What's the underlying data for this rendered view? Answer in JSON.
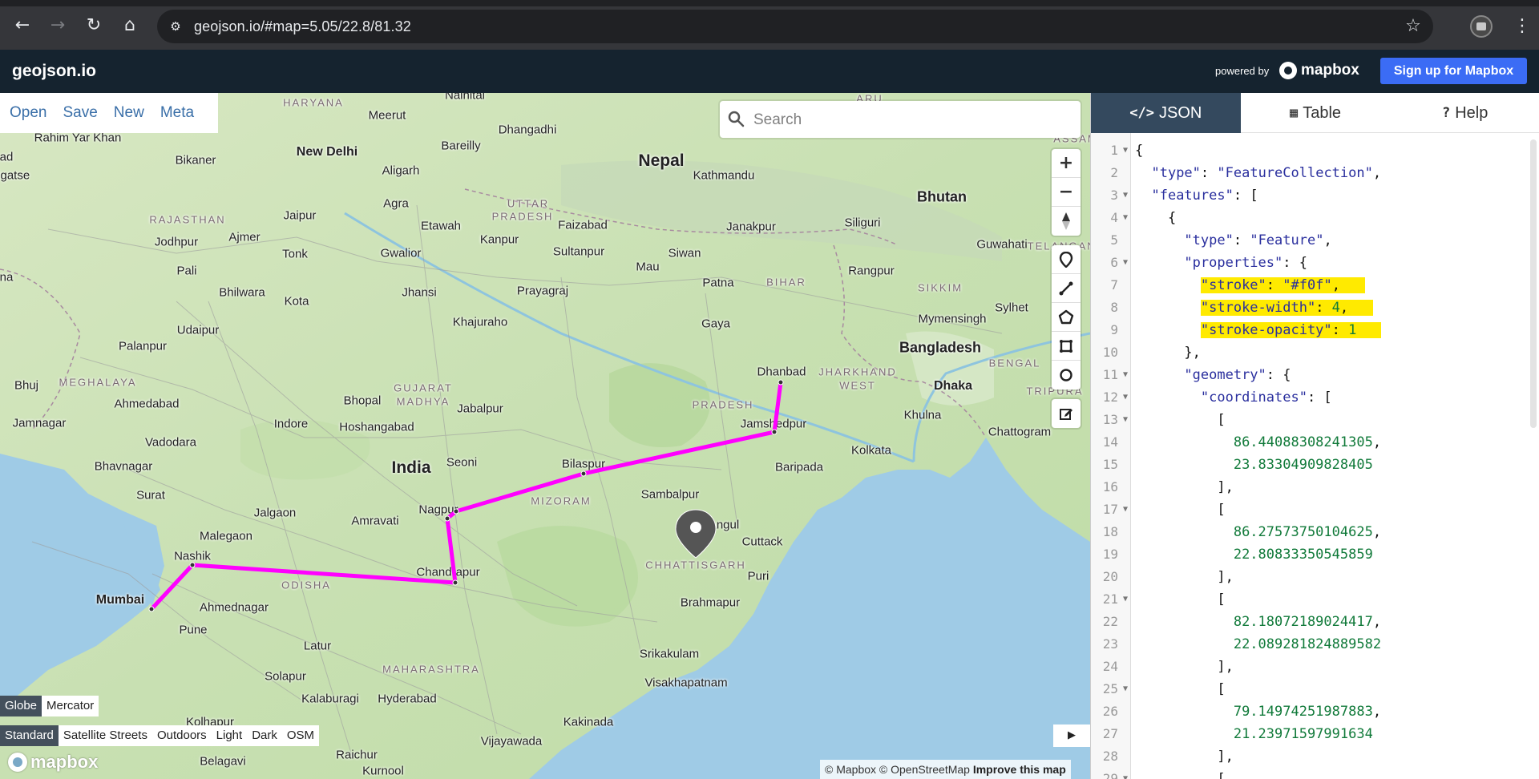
{
  "browser": {
    "url": "geojson.io/#map=5.05/22.8/81.32",
    "back_icon": "arrow-left-icon",
    "forward_icon": "arrow-right-icon",
    "reload_icon": "reload-icon",
    "home_icon": "home-icon",
    "star_icon": "star-icon"
  },
  "header": {
    "brand": "geojson.io",
    "powered_by": "powered by",
    "mapbox": "mapbox",
    "signup": "Sign up for Mapbox"
  },
  "file_menu": [
    "Open",
    "Save",
    "New",
    "Meta"
  ],
  "search": {
    "placeholder": "Search"
  },
  "projection": {
    "options": [
      "Globe",
      "Mercator"
    ],
    "active": "Globe"
  },
  "styles": {
    "options": [
      "Standard",
      "Satellite Streets",
      "Outdoors",
      "Light",
      "Dark",
      "OSM"
    ],
    "active": "Standard"
  },
  "attribution": {
    "mapbox": "© Mapbox",
    "osm": "© OpenStreetMap",
    "improve": "Improve this map"
  },
  "map_logo": "mapbox",
  "tabs": [
    {
      "icon": "</>",
      "label": "JSON"
    },
    {
      "icon": "▦",
      "label": "Table"
    },
    {
      "icon": "?",
      "label": "Help"
    }
  ],
  "active_tab": "JSON",
  "line_color": "#f0f",
  "map_labels": [
    {
      "text": "Nepal",
      "cls": "big"
    },
    {
      "text": "India",
      "cls": "big"
    },
    {
      "text": "Bhutan",
      "cls": "country"
    },
    {
      "text": "Bangladesh",
      "cls": "country"
    },
    {
      "text": "New Delhi",
      "cls": "medium"
    },
    {
      "text": "Mumbai",
      "cls": "medium"
    },
    {
      "text": "Dhaka",
      "cls": "medium"
    },
    {
      "text": "Kathmandu",
      "cls": "city"
    },
    {
      "text": "Meerut",
      "cls": "city"
    },
    {
      "text": "Bareilly",
      "cls": "city"
    },
    {
      "text": "Aligarh",
      "cls": "city"
    },
    {
      "text": "Agra",
      "cls": "city"
    },
    {
      "text": "Jaipur",
      "cls": "city"
    },
    {
      "text": "Bikaner",
      "cls": "city"
    },
    {
      "text": "Rahim Yar Khan",
      "cls": "city"
    },
    {
      "text": "Jodhpur",
      "cls": "city"
    },
    {
      "text": "Ajmer",
      "cls": "city"
    },
    {
      "text": "Pali",
      "cls": "city"
    },
    {
      "text": "Tonk",
      "cls": "city"
    },
    {
      "text": "Gwalior",
      "cls": "city"
    },
    {
      "text": "Etawah",
      "cls": "city"
    },
    {
      "text": "Kanpur",
      "cls": "city"
    },
    {
      "text": "Faizabad",
      "cls": "city"
    },
    {
      "text": "Sultanpur",
      "cls": "city"
    },
    {
      "text": "Janakpur",
      "cls": "city"
    },
    {
      "text": "Siliguri",
      "cls": "city"
    },
    {
      "text": "Guwahati",
      "cls": "city"
    },
    {
      "text": "Rangpur",
      "cls": "city"
    },
    {
      "text": "Siwan",
      "cls": "city"
    },
    {
      "text": "Mau",
      "cls": "city"
    },
    {
      "text": "Patna",
      "cls": "city"
    },
    {
      "text": "Prayagraj",
      "cls": "city"
    },
    {
      "text": "Jhansi",
      "cls": "city"
    },
    {
      "text": "Bhilwara",
      "cls": "city"
    },
    {
      "text": "Kota",
      "cls": "city"
    },
    {
      "text": "Udaipur",
      "cls": "city"
    },
    {
      "text": "Palanpur",
      "cls": "city"
    },
    {
      "text": "Khajuraho",
      "cls": "city"
    },
    {
      "text": "Gaya",
      "cls": "city"
    },
    {
      "text": "Mymensingh",
      "cls": "city"
    },
    {
      "text": "Sylhet",
      "cls": "city"
    },
    {
      "text": "Dhanbad",
      "cls": "city"
    },
    {
      "text": "Bhuj",
      "cls": "city"
    },
    {
      "text": "Ahmedabad",
      "cls": "city"
    },
    {
      "text": "Bhopal",
      "cls": "city"
    },
    {
      "text": "Jabalpur",
      "cls": "city"
    },
    {
      "text": "Indore",
      "cls": "city"
    },
    {
      "text": "Hoshangabad",
      "cls": "city"
    },
    {
      "text": "Jamshedpur",
      "cls": "city"
    },
    {
      "text": "Khulna",
      "cls": "city"
    },
    {
      "text": "Chattogram",
      "cls": "city"
    },
    {
      "text": "Jamnagar",
      "cls": "city"
    },
    {
      "text": "Vadodara",
      "cls": "city"
    },
    {
      "text": "Kolkata",
      "cls": "city"
    },
    {
      "text": "Bhavnagar",
      "cls": "city"
    },
    {
      "text": "Seoni",
      "cls": "city"
    },
    {
      "text": "Bilaspur",
      "cls": "city"
    },
    {
      "text": "Baripada",
      "cls": "city"
    },
    {
      "text": "Surat",
      "cls": "city"
    },
    {
      "text": "Sambalpur",
      "cls": "city"
    },
    {
      "text": "Jalgaon",
      "cls": "city"
    },
    {
      "text": "Amravati",
      "cls": "city"
    },
    {
      "text": "Nagpur",
      "cls": "city"
    },
    {
      "text": "Angul",
      "cls": "city"
    },
    {
      "text": "Malegaon",
      "cls": "city"
    },
    {
      "text": "Cuttack",
      "cls": "city"
    },
    {
      "text": "Nashik",
      "cls": "city"
    },
    {
      "text": "Chandrapur",
      "cls": "city"
    },
    {
      "text": "Puri",
      "cls": "city"
    },
    {
      "text": "Ahmednagar",
      "cls": "city"
    },
    {
      "text": "Brahmapur",
      "cls": "city"
    },
    {
      "text": "Pune",
      "cls": "city"
    },
    {
      "text": "Latur",
      "cls": "city"
    },
    {
      "text": "Srikakulam",
      "cls": "city"
    },
    {
      "text": "Solapur",
      "cls": "city"
    },
    {
      "text": "Visakhapatnam",
      "cls": "city"
    },
    {
      "text": "Kalaburagi",
      "cls": "city"
    },
    {
      "text": "Hyderabad",
      "cls": "city"
    },
    {
      "text": "Kolhapur",
      "cls": "city"
    },
    {
      "text": "Kakinada",
      "cls": "city"
    },
    {
      "text": "Vijayawada",
      "cls": "city"
    },
    {
      "text": "Raichur",
      "cls": "city"
    },
    {
      "text": "Belagavi",
      "cls": "city"
    },
    {
      "text": "Kurnool",
      "cls": "city"
    },
    {
      "text": "Nainital",
      "cls": "city"
    },
    {
      "text": "Dhangadhi",
      "cls": "city"
    },
    {
      "text": "HARYANA",
      "cls": "state"
    },
    {
      "text": "UTTAR",
      "cls": "state"
    },
    {
      "text": "PRADESH",
      "cls": "state"
    },
    {
      "text": "RAJASTHAN",
      "cls": "state"
    },
    {
      "text": "BIHAR",
      "cls": "state"
    },
    {
      "text": "SIKKIM",
      "cls": "state"
    },
    {
      "text": "MEGHALAYA",
      "cls": "state"
    },
    {
      "text": "GUJARAT",
      "cls": "state"
    },
    {
      "text": "MADHYA",
      "cls": "state"
    },
    {
      "text": "PRADESH",
      "cls": "state"
    },
    {
      "text": "JHARKHAND",
      "cls": "state"
    },
    {
      "text": "WEST",
      "cls": "state"
    },
    {
      "text": "BENGAL",
      "cls": "state"
    },
    {
      "text": "TRIPURA",
      "cls": "state"
    },
    {
      "text": "MIZORAM",
      "cls": "state"
    },
    {
      "text": "CHHATTISGARH",
      "cls": "state"
    },
    {
      "text": "ODISHA",
      "cls": "state"
    },
    {
      "text": "MAHARASHTRA",
      "cls": "state"
    },
    {
      "text": "TELANGANA",
      "cls": "state"
    },
    {
      "text": "ASSAM",
      "cls": "state"
    },
    {
      "text": "ARU",
      "cls": "state"
    },
    {
      "text": "Shigatse",
      "cls": "city"
    },
    {
      "text": "na",
      "cls": "city"
    },
    {
      "text": "ad",
      "cls": "city"
    },
    {
      "text": "an",
      "cls": "city"
    }
  ],
  "editor_lines": [
    {
      "n": "1",
      "fold": true,
      "code": "{"
    },
    {
      "n": "2",
      "fold": false,
      "code": "  \"type\": \"FeatureCollection\","
    },
    {
      "n": "3",
      "fold": true,
      "code": "  \"features\": ["
    },
    {
      "n": "4",
      "fold": true,
      "code": "    {"
    },
    {
      "n": "5",
      "fold": false,
      "code": "      \"type\": \"Feature\","
    },
    {
      "n": "6",
      "fold": true,
      "code": "      \"properties\": {"
    },
    {
      "n": "7",
      "fold": false,
      "code": "        \"stroke\": \"#f0f\",",
      "hl": true
    },
    {
      "n": "8",
      "fold": false,
      "code": "        \"stroke-width\": 4,",
      "hl": true
    },
    {
      "n": "9",
      "fold": false,
      "code": "        \"stroke-opacity\": 1",
      "hl": true
    },
    {
      "n": "10",
      "fold": false,
      "code": "      },"
    },
    {
      "n": "11",
      "fold": true,
      "code": "      \"geometry\": {"
    },
    {
      "n": "12",
      "fold": true,
      "code": "        \"coordinates\": ["
    },
    {
      "n": "13",
      "fold": true,
      "code": "          ["
    },
    {
      "n": "14",
      "fold": false,
      "code": "            86.44088308241305,"
    },
    {
      "n": "15",
      "fold": false,
      "code": "            23.83304909828405"
    },
    {
      "n": "16",
      "fold": false,
      "code": "          ],"
    },
    {
      "n": "17",
      "fold": true,
      "code": "          ["
    },
    {
      "n": "18",
      "fold": false,
      "code": "            86.27573750104625,"
    },
    {
      "n": "19",
      "fold": false,
      "code": "            22.80833350545859"
    },
    {
      "n": "20",
      "fold": false,
      "code": "          ],"
    },
    {
      "n": "21",
      "fold": true,
      "code": "          ["
    },
    {
      "n": "22",
      "fold": false,
      "code": "            82.18072189024417,"
    },
    {
      "n": "23",
      "fold": false,
      "code": "            22.089281824889582"
    },
    {
      "n": "24",
      "fold": false,
      "code": "          ],"
    },
    {
      "n": "25",
      "fold": true,
      "code": "          ["
    },
    {
      "n": "26",
      "fold": false,
      "code": "            79.14974251987883,"
    },
    {
      "n": "27",
      "fold": false,
      "code": "            21.23971597991634"
    },
    {
      "n": "28",
      "fold": false,
      "code": "          ],"
    },
    {
      "n": "29",
      "fold": true,
      "code": "          ["
    }
  ]
}
